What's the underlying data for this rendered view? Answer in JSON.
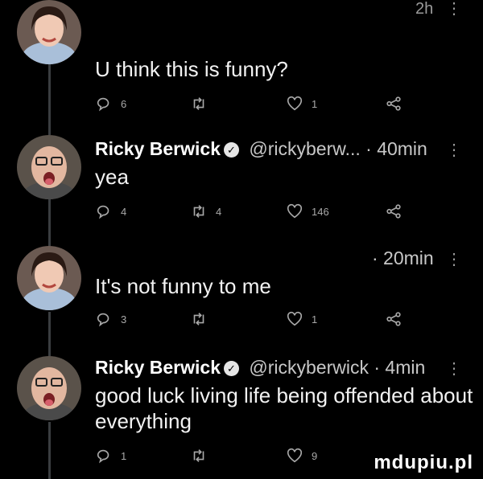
{
  "top": {
    "time": "2h"
  },
  "tweets": [
    {
      "text": "U think this is funny?",
      "replies": "6",
      "retweets": "",
      "likes": "1"
    },
    {
      "name": "Ricky Berwick",
      "handle": "@rickyberw...",
      "time": "· 40min",
      "text": "yea",
      "replies": "4",
      "retweets": "4",
      "likes": "146"
    },
    {
      "time": "· 20min",
      "text": "It's not funny to me",
      "replies": "3",
      "retweets": "",
      "likes": "1"
    },
    {
      "name": "Ricky Berwick",
      "handle": "@rickyberwick",
      "time": "· 4min",
      "text": "good luck living life being offended about everything",
      "replies": "1",
      "retweets": "",
      "likes": "9"
    }
  ],
  "icons": {
    "reply": "reply-icon",
    "retweet": "retweet-icon",
    "like": "heart-icon",
    "share": "share-icon",
    "verified": "verified-icon",
    "more": "more-icon"
  },
  "colors": {
    "background": "#000000",
    "text": "#ffffff",
    "muted": "#a8a8a8",
    "thread": "#3a3d40"
  },
  "watermark": "mdupiu.pl"
}
